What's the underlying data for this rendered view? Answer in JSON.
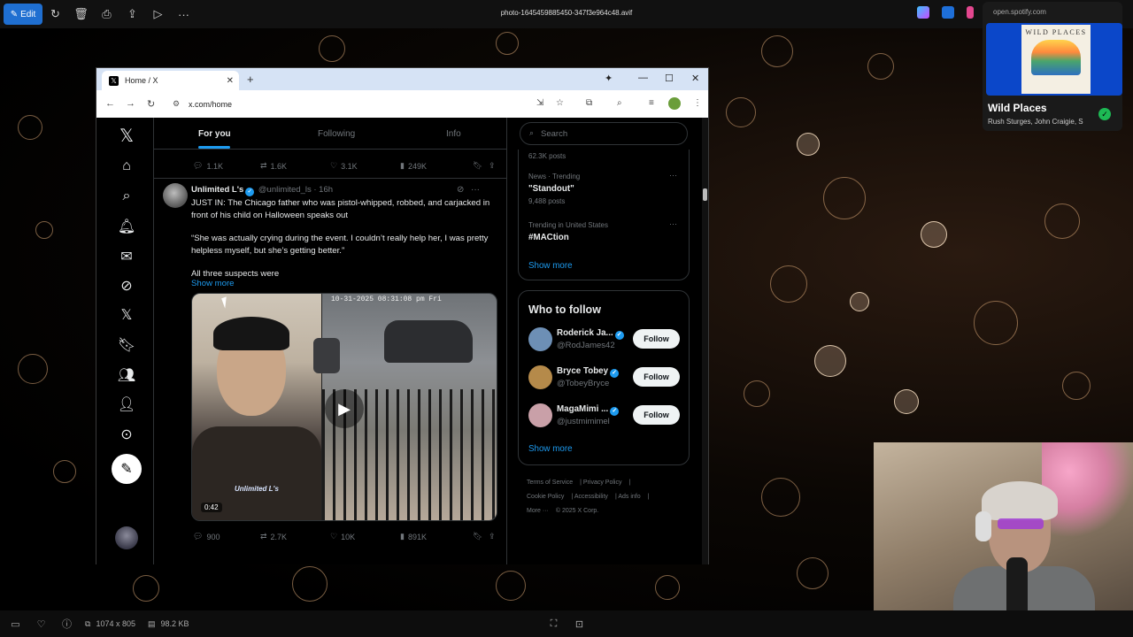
{
  "viewer": {
    "edit_label": "Edit",
    "filename": "photo-1645459885450-347f3e964c48.avif",
    "dimensions": "1074 x 805",
    "filesize": "98.2 KB"
  },
  "spotify": {
    "url": "open.spotify.com",
    "cover_text": "WILD PLACES",
    "title": "Wild Places",
    "artist": "Rush Sturges, John Craigie, S"
  },
  "browser": {
    "tab_title": "Home / X",
    "url": "x.com/home"
  },
  "feed": {
    "tabs": [
      "For you",
      "Following",
      "Info"
    ],
    "prev_actions": {
      "replies": "1.1K",
      "reposts": "1.6K",
      "likes": "3.1K",
      "views": "249K"
    },
    "tweet": {
      "name": "Unlimited L's",
      "handle": "@unlimited_ls",
      "time": "· 16h",
      "line1": "JUST IN: The Chicago father who was pistol-whipped, robbed, and carjacked in front of his child on Halloween speaks out",
      "line2": "“She was actually crying during the event. I couldn’t really help her, I was pretty helpless myself, but she’s getting better.”",
      "line3": "All three suspects were",
      "show_more": "Show more",
      "video_duration": "0:42",
      "watermark": "Unlimited L's",
      "cctv_stamp": "10-31-2025 08:31:08 pm Fri",
      "replies": "900",
      "reposts": "2.7K",
      "likes": "10K",
      "views": "891K"
    }
  },
  "sidebar": {
    "search_placeholder": "Search",
    "trends": [
      {
        "meta": "",
        "name": "",
        "posts": "62.3K posts"
      },
      {
        "meta": "News · Trending",
        "name": "\"Standout\"",
        "posts": "9,488 posts"
      },
      {
        "meta": "Trending in United States",
        "name": "#MACtion",
        "posts": ""
      }
    ],
    "show_more": "Show more",
    "who_to_follow": {
      "title": "Who to follow",
      "users": [
        {
          "name": "Roderick Ja...",
          "handle": "@RodJames42",
          "button": "Follow",
          "avatar_color": "#6d8fb5"
        },
        {
          "name": "Bryce Tobey",
          "handle": "@TobeyBryce",
          "button": "Follow",
          "avatar_color": "#b58a4a"
        },
        {
          "name": "MagaMimi ...",
          "handle": "@justmimimel",
          "button": "Follow",
          "avatar_color": "#c9a0a8"
        }
      ],
      "show_more": "Show more"
    },
    "footer": {
      "terms": "Terms of Service",
      "privacy": "Privacy Policy",
      "cookie": "Cookie Policy",
      "accessibility": "Accessibility",
      "ads": "Ads info",
      "more": "More ···",
      "copyright": "© 2025 X Corp."
    }
  },
  "colors": {
    "accent": "#1d9bf0",
    "edit_button": "#1f6fd1",
    "spotify_green": "#1db954"
  }
}
